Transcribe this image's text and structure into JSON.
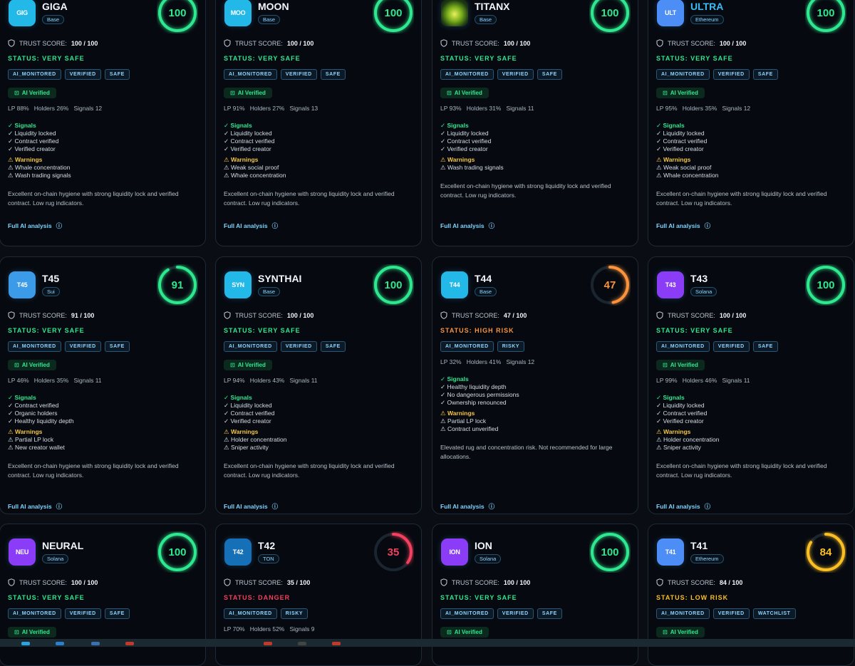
{
  "labels": {
    "trust_prefix": "TRUST SCORE:",
    "ai_verified": "AI Verified",
    "signals": "Signals",
    "warnings": "Warnings",
    "full_analysis": "Full AI analysis"
  },
  "colors": {
    "safe": "#2ee88f",
    "high_risk": "#fb923c",
    "danger": "#f43f5e",
    "low_risk": "#fbbf24",
    "accent": "#7dd3fc"
  },
  "cards": [
    {
      "logo": "GIG",
      "logo_color": "#22b8e8",
      "name": "GIGA",
      "name_color": "#f2f6fa",
      "chain": "Base",
      "score": 100,
      "score_text": "100",
      "trust_value": "100 / 100",
      "status": "STATUS: VERY SAFE",
      "status_color": "#2ee88f",
      "ring_color": "#2ee88f",
      "tags": [
        "AI_MONITORED",
        "VERIFIED",
        "SAFE"
      ],
      "ai_verified": true,
      "stats": "LP 88%   Holders 26%   Signals 12",
      "signals": [
        "✓ Liquidity locked",
        "✓ Contract verified",
        "✓ Verified creator"
      ],
      "warnings": [
        "⚠ Whale concentration",
        "⚠ Wash trading signals"
      ],
      "description": "Excellent on-chain hygiene with strong liquidity lock and verified contract. Low rug indicators."
    },
    {
      "logo": "MOO",
      "logo_color": "#22b8e8",
      "name": "MOON",
      "name_color": "#f2f6fa",
      "chain": "Base",
      "score": 100,
      "score_text": "100",
      "trust_value": "100 / 100",
      "status": "STATUS: VERY SAFE",
      "status_color": "#2ee88f",
      "ring_color": "#2ee88f",
      "tags": [
        "AI_MONITORED",
        "VERIFIED",
        "SAFE"
      ],
      "ai_verified": true,
      "stats": "LP 91%   Holders 27%   Signals 13",
      "signals": [
        "✓ Liquidity locked",
        "✓ Contract verified",
        "✓ Verified creator"
      ],
      "warnings": [
        "⚠ Weak social proof",
        "⚠ Whale concentration"
      ],
      "description": "Excellent on-chain hygiene with strong liquidity lock and verified contract. Low rug indicators."
    },
    {
      "logo": "",
      "logo_color": "#0f2a1c",
      "logo_image": true,
      "name": "TITANX",
      "name_color": "#f2f6fa",
      "chain": "Base",
      "score": 100,
      "score_text": "100",
      "trust_value": "100 / 100",
      "status": "STATUS: VERY SAFE",
      "status_color": "#2ee88f",
      "ring_color": "#2ee88f",
      "tags": [
        "AI_MONITORED",
        "VERIFIED",
        "SAFE"
      ],
      "ai_verified": true,
      "stats": "LP 93%   Holders 31%   Signals 11",
      "signals": [
        "✓ Liquidity locked",
        "✓ Contract verified",
        "✓ Verified creator"
      ],
      "warnings": [
        "⚠ Wash trading signals"
      ],
      "description": "Excellent on-chain hygiene with strong liquidity lock and verified contract. Low rug indicators."
    },
    {
      "logo": "ULT",
      "logo_color": "#4c8df6",
      "name": "ULTRA",
      "name_color": "#38bdf8",
      "chain": "Ethereum",
      "score": 100,
      "score_text": "100",
      "trust_value": "100 / 100",
      "status": "STATUS: VERY SAFE",
      "status_color": "#2ee88f",
      "ring_color": "#2ee88f",
      "tags": [
        "AI_MONITORED",
        "VERIFIED",
        "SAFE"
      ],
      "ai_verified": true,
      "stats": "LP 95%   Holders 35%   Signals 12",
      "signals": [
        "✓ Liquidity locked",
        "✓ Contract verified",
        "✓ Verified creator"
      ],
      "warnings": [
        "⚠ Weak social proof",
        "⚠ Whale concentration"
      ],
      "description": "Excellent on-chain hygiene with strong liquidity lock and verified contract. Low rug indicators."
    },
    {
      "logo": "T45",
      "logo_color": "#3b9be8",
      "name": "T45",
      "name_color": "#f2f6fa",
      "chain": "Sui",
      "score": 91,
      "score_text": "91",
      "trust_value": "91 / 100",
      "status": "STATUS: VERY SAFE",
      "status_color": "#2ee88f",
      "ring_color": "#2ee88f",
      "tags": [
        "AI_MONITORED",
        "VERIFIED",
        "SAFE"
      ],
      "ai_verified": true,
      "stats": "LP 46%   Holders 35%   Signals 11",
      "signals": [
        "✓ Contract verified",
        "✓ Organic holders",
        "✓ Healthy liquidity depth"
      ],
      "warnings": [
        "⚠ Partial LP lock",
        "⚠ New creator wallet"
      ],
      "description": "Excellent on-chain hygiene with strong liquidity lock and verified contract. Low rug indicators."
    },
    {
      "logo": "SYN",
      "logo_color": "#22b8e8",
      "name": "SYNTHAI",
      "name_color": "#f2f6fa",
      "chain": "Base",
      "score": 100,
      "score_text": "100",
      "trust_value": "100 / 100",
      "status": "STATUS: VERY SAFE",
      "status_color": "#2ee88f",
      "ring_color": "#2ee88f",
      "tags": [
        "AI_MONITORED",
        "VERIFIED",
        "SAFE"
      ],
      "ai_verified": true,
      "stats": "LP 94%   Holders 43%   Signals 11",
      "signals": [
        "✓ Liquidity locked",
        "✓ Contract verified",
        "✓ Verified creator"
      ],
      "warnings": [
        "⚠ Holder concentration",
        "⚠ Sniper activity"
      ],
      "description": "Excellent on-chain hygiene with strong liquidity lock and verified contract. Low rug indicators."
    },
    {
      "logo": "T44",
      "logo_color": "#22b8e8",
      "name": "T44",
      "name_color": "#f2f6fa",
      "chain": "Base",
      "score": 47,
      "score_text": "47",
      "trust_value": "47 / 100",
      "status": "STATUS: HIGH RISK",
      "status_color": "#fb923c",
      "ring_color": "#fb923c",
      "tags": [
        "AI_MONITORED",
        "RISKY"
      ],
      "ai_verified": false,
      "stats": "LP 32%   Holders 41%   Signals 12",
      "signals": [
        "✓ Healthy liquidity depth",
        "✓ No dangerous permissions",
        "✓ Ownership renounced"
      ],
      "warnings": [
        "⚠ Partial LP lock",
        "⚠ Contract unverified"
      ],
      "description": "Elevated rug and concentration risk. Not recommended for large allocations."
    },
    {
      "logo": "T43",
      "logo_color": "#8b3cf6",
      "name": "T43",
      "name_color": "#f2f6fa",
      "chain": "Solana",
      "score": 100,
      "score_text": "100",
      "trust_value": "100 / 100",
      "status": "STATUS: VERY SAFE",
      "status_color": "#2ee88f",
      "ring_color": "#2ee88f",
      "tags": [
        "AI_MONITORED",
        "VERIFIED",
        "SAFE"
      ],
      "ai_verified": true,
      "stats": "LP 99%   Holders 46%   Signals 11",
      "signals": [
        "✓ Liquidity locked",
        "✓ Contract verified",
        "✓ Verified creator"
      ],
      "warnings": [
        "⚠ Holder concentration",
        "⚠ Sniper activity"
      ],
      "description": "Excellent on-chain hygiene with strong liquidity lock and verified contract. Low rug indicators."
    },
    {
      "logo": "NEU",
      "logo_color": "#8b3cf6",
      "name": "NEURAL",
      "name_color": "#f2f6fa",
      "chain": "Solana",
      "score": 100,
      "score_text": "100",
      "trust_value": "100 / 100",
      "status": "STATUS: VERY SAFE",
      "status_color": "#2ee88f",
      "ring_color": "#2ee88f",
      "tags": [
        "AI_MONITORED",
        "VERIFIED",
        "SAFE"
      ],
      "ai_verified": true,
      "stats": "",
      "signals": [],
      "warnings": [],
      "description": ""
    },
    {
      "logo": "T42",
      "logo_color": "#1570b8",
      "name": "T42",
      "name_color": "#f2f6fa",
      "chain": "TON",
      "score": 35,
      "score_text": "35",
      "trust_value": "35 / 100",
      "status": "STATUS: DANGER",
      "status_color": "#f43f5e",
      "ring_color": "#f43f5e",
      "tags": [
        "AI_MONITORED",
        "RISKY"
      ],
      "ai_verified": false,
      "stats": "LP 70%   Holders 52%   Signals 9",
      "signals": [],
      "warnings": [],
      "description": ""
    },
    {
      "logo": "ION",
      "logo_color": "#8b3cf6",
      "name": "ION",
      "name_color": "#f2f6fa",
      "chain": "Solana",
      "score": 100,
      "score_text": "100",
      "trust_value": "100 / 100",
      "status": "STATUS: VERY SAFE",
      "status_color": "#2ee88f",
      "ring_color": "#2ee88f",
      "tags": [
        "AI_MONITORED",
        "VERIFIED",
        "SAFE"
      ],
      "ai_verified": true,
      "stats": "",
      "signals": [],
      "warnings": [],
      "description": ""
    },
    {
      "logo": "T41",
      "logo_color": "#4c8df6",
      "name": "T41",
      "name_color": "#f2f6fa",
      "chain": "Ethereum",
      "score": 84,
      "score_text": "84",
      "trust_value": "84 / 100",
      "status": "STATUS: LOW RISK",
      "status_color": "#fbbf24",
      "ring_color": "#fbbf24",
      "tags": [
        "AI_MONITORED",
        "VERIFIED",
        "WATCHLIST"
      ],
      "ai_verified": true,
      "stats": "",
      "signals": [],
      "warnings": [],
      "description": ""
    }
  ]
}
